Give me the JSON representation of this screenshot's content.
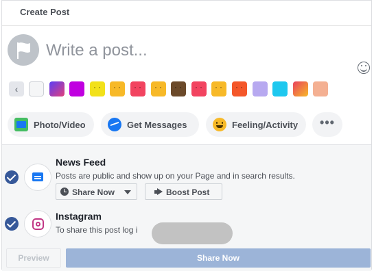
{
  "header": {
    "title": "Create Post"
  },
  "composer": {
    "placeholder": "Write a post...",
    "avatar_icon": "flag-icon",
    "emoji_icon": "smiley-icon"
  },
  "backgrounds": {
    "prev_glyph": "‹",
    "items": [
      {
        "kind": "white",
        "color": "#f5f6f7"
      },
      {
        "kind": "gradient",
        "color": "linear-gradient(135deg,#5b3df5,#e2407a)"
      },
      {
        "kind": "solid",
        "color": "#c000e0"
      },
      {
        "kind": "face",
        "color": "#f2e11a"
      },
      {
        "kind": "face",
        "color": "#f7b928"
      },
      {
        "kind": "face",
        "color": "#f24460"
      },
      {
        "kind": "face",
        "color": "#f7b928"
      },
      {
        "kind": "face",
        "color": "#6b4a2a"
      },
      {
        "kind": "face",
        "color": "#f24460"
      },
      {
        "kind": "face",
        "color": "#f7b928"
      },
      {
        "kind": "face",
        "color": "#f4572a"
      },
      {
        "kind": "solid",
        "color": "#b7a9f0"
      },
      {
        "kind": "solid",
        "color": "#1ec8ef"
      },
      {
        "kind": "gradient",
        "color": "linear-gradient(135deg,#e9415e,#f7b928)"
      },
      {
        "kind": "solid",
        "color": "#f4b092"
      }
    ]
  },
  "actions": {
    "photo_video": "Photo/Video",
    "get_messages": "Get Messages",
    "feeling_activity": "Feeling/Activity",
    "more": "•••"
  },
  "destinations": {
    "news_feed": {
      "title": "News Feed",
      "description": "Posts are public and show up on your Page and in search results.",
      "share_now_label": "Share Now",
      "boost_label": "Boost Post"
    },
    "instagram": {
      "title": "Instagram",
      "description": "To share this post log i"
    }
  },
  "footer": {
    "preview": "Preview",
    "share_now": "Share Now"
  },
  "colors": {
    "accent": "#365899",
    "share_button_disabled": "#9cb4d8"
  }
}
